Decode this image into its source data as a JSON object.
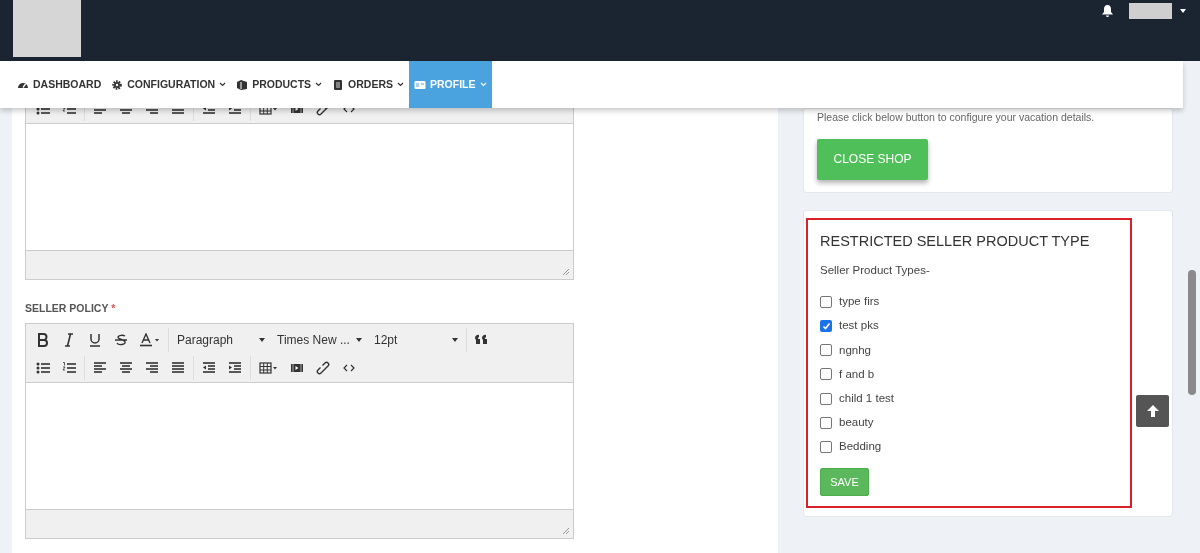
{
  "nav": [
    {
      "label": "DASHBOARD",
      "dropdown": false,
      "selected": false
    },
    {
      "label": "CONFIGURATION",
      "dropdown": true,
      "selected": false
    },
    {
      "label": "PRODUCTS",
      "dropdown": true,
      "selected": false
    },
    {
      "label": "ORDERS",
      "dropdown": true,
      "selected": false
    },
    {
      "label": "PROFILE",
      "dropdown": true,
      "selected": true
    }
  ],
  "editors": [
    {
      "kind": "scrolled"
    },
    {
      "kind": "full",
      "label": "SELLER POLICY",
      "required": "*",
      "formats": {
        "block": "Paragraph",
        "font": "Times New ...",
        "size": "12pt"
      }
    }
  ],
  "vacation": {
    "text": "Please click below button to configure your vacation details.",
    "button": "CLOSE SHOP"
  },
  "restricted": {
    "title": "RESTRICTED SELLER PRODUCT TYPE",
    "subtitle": "Seller Product Types-",
    "save": "SAVE",
    "types": [
      {
        "label": "type firs",
        "checked": false
      },
      {
        "label": "test pks",
        "checked": true
      },
      {
        "label": "ngnhg",
        "checked": false
      },
      {
        "label": "f and b",
        "checked": false
      },
      {
        "label": "child 1 test",
        "checked": false
      },
      {
        "label": "beauty",
        "checked": false
      },
      {
        "label": "Bedding",
        "checked": false
      }
    ]
  }
}
